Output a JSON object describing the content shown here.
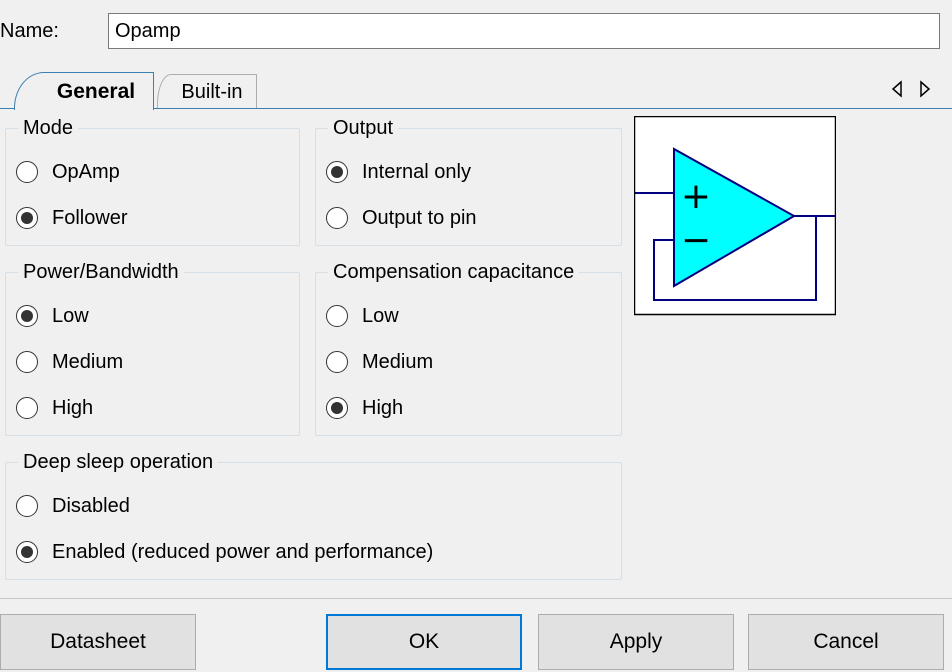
{
  "name_row": {
    "label": "Name:",
    "value": "Opamp"
  },
  "tabs": [
    {
      "label": "General",
      "active": true
    },
    {
      "label": "Built-in",
      "active": false
    }
  ],
  "tab_scroll": {
    "left_icon": "triangle-left-icon",
    "right_icon": "triangle-right-icon"
  },
  "groups": {
    "mode": {
      "title": "Mode",
      "options": [
        {
          "label": "OpAmp",
          "checked": false
        },
        {
          "label": "Follower",
          "checked": true
        }
      ]
    },
    "output": {
      "title": "Output",
      "options": [
        {
          "label": "Internal only",
          "checked": true
        },
        {
          "label": "Output to pin",
          "checked": false
        }
      ]
    },
    "power": {
      "title": "Power/Bandwidth",
      "options": [
        {
          "label": "Low",
          "checked": true
        },
        {
          "label": "Medium",
          "checked": false
        },
        {
          "label": "High",
          "checked": false
        }
      ]
    },
    "compensation": {
      "title": "Compensation capacitance",
      "options": [
        {
          "label": "Low",
          "checked": false
        },
        {
          "label": "Medium",
          "checked": false
        },
        {
          "label": "High",
          "checked": true
        }
      ]
    },
    "deep_sleep": {
      "title": "Deep sleep operation",
      "options": [
        {
          "label": "Disabled",
          "checked": false
        },
        {
          "label": "Enabled (reduced power and performance)",
          "checked": true
        }
      ]
    }
  },
  "diagram": {
    "icon": "opamp-follower-icon",
    "plus_sign": "+",
    "minus_sign": "−",
    "colors": {
      "triangle_fill": "#00ffff",
      "wire": "#000080"
    }
  },
  "buttons": {
    "datasheet": "Datasheet",
    "ok": "OK",
    "apply": "Apply",
    "cancel": "Cancel"
  },
  "colors": {
    "tab_border": "#3c7fb1",
    "focus_border": "#0078d7"
  }
}
